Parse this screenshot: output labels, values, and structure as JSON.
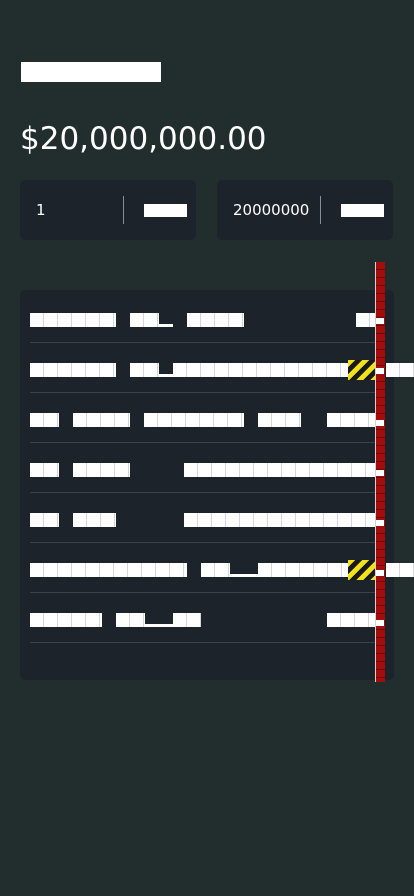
{
  "header": {
    "title": "",
    "amount": "$20,000,000.00"
  },
  "inputs": [
    {
      "value": "1",
      "unit_label": ""
    },
    {
      "value": "20000000",
      "unit_label": ""
    }
  ],
  "list": {
    "rows": [
      {
        "label": "",
        "badge": "none"
      },
      {
        "label": "",
        "badge": "hazard"
      },
      {
        "label": "",
        "badge": "none"
      },
      {
        "label": "",
        "badge": "none"
      },
      {
        "label": "",
        "badge": "none"
      },
      {
        "label": "",
        "badge": "hazard"
      },
      {
        "label": "",
        "badge": "none"
      }
    ]
  },
  "colors": {
    "background": "#222d2d",
    "card": "#1c232a",
    "text": "#ffffff",
    "divider": "#3a434b",
    "marker": "#a40b0b",
    "hazard_yellow": "#f2e21b"
  },
  "icons": {
    "hazard": "hazard-stripe-icon",
    "marker": "scroll-marker-strip"
  }
}
